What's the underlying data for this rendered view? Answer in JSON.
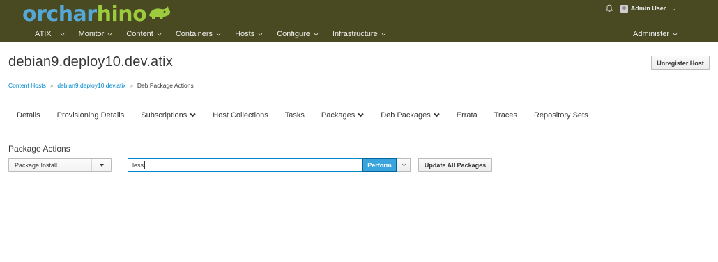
{
  "brand": {
    "logo_prefix": "orchar",
    "logo_suffix": "hino",
    "colors": {
      "primary": "#55a7d6",
      "accent": "#9ccc3d",
      "navbar": "#4a4a22",
      "link": "#0088ce",
      "perform": "#39a5dc"
    }
  },
  "util_bar": {
    "notification_icon": "bell-icon",
    "user_label": "Admin User"
  },
  "menu": {
    "items": [
      {
        "label": "ATIX"
      },
      {
        "label": "Monitor"
      },
      {
        "label": "Content"
      },
      {
        "label": "Containers"
      },
      {
        "label": "Hosts"
      },
      {
        "label": "Configure"
      },
      {
        "label": "Infrastructure"
      }
    ],
    "administer_label": "Administer"
  },
  "page": {
    "title": "debian9.deploy10.dev.atix",
    "unregister_label": "Unregister Host"
  },
  "breadcrumb": {
    "items": [
      "Content Hosts",
      "debian9.deploy10.dev.atix"
    ],
    "current": "Deb Package Actions"
  },
  "tabs": [
    {
      "label": "Details"
    },
    {
      "label": "Provisioning Details"
    },
    {
      "label": "Subscriptions",
      "dropdown": true
    },
    {
      "label": "Host Collections"
    },
    {
      "label": "Tasks"
    },
    {
      "label": "Packages",
      "dropdown": true
    },
    {
      "label": "Deb Packages",
      "dropdown": true
    },
    {
      "label": "Errata"
    },
    {
      "label": "Traces"
    },
    {
      "label": "Repository Sets"
    }
  ],
  "package_actions": {
    "title": "Package Actions",
    "action_select": "Package Install",
    "input_value": "less",
    "perform_label": "Perform",
    "update_all_label": "Update All Packages"
  }
}
